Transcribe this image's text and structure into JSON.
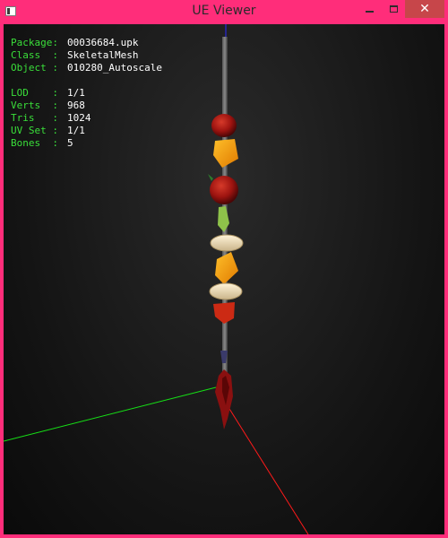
{
  "window": {
    "title": "UE Viewer",
    "close_glyph": "✕"
  },
  "info": {
    "package": {
      "label": "Package:",
      "value": "00036684.upk"
    },
    "class": {
      "label": "Class  :",
      "value": "SkeletalMesh"
    },
    "object": {
      "label": "Object :",
      "value": "010280_Autoscale"
    },
    "lod": {
      "label": "LOD    :",
      "value": "1/1"
    },
    "verts": {
      "label": "Verts  :",
      "value": "968"
    },
    "tris": {
      "label": "Tris   :",
      "value": "1024"
    },
    "uvset": {
      "label": "UV Set :",
      "value": "1/1"
    },
    "bones": {
      "label": "Bones  :",
      "value": "5"
    }
  },
  "colors": {
    "frame": "#ff2d7a",
    "label_text": "#3adf3a",
    "value_text": "#ffffff",
    "axis_x": "#ff1a1a",
    "axis_y": "#16e016",
    "axis_z": "#2a2aff",
    "close_button": "#c7464a"
  },
  "icons": {
    "app": "app-icon",
    "minimize": "minimize-icon",
    "maximize": "maximize-icon",
    "close": "close-icon"
  }
}
